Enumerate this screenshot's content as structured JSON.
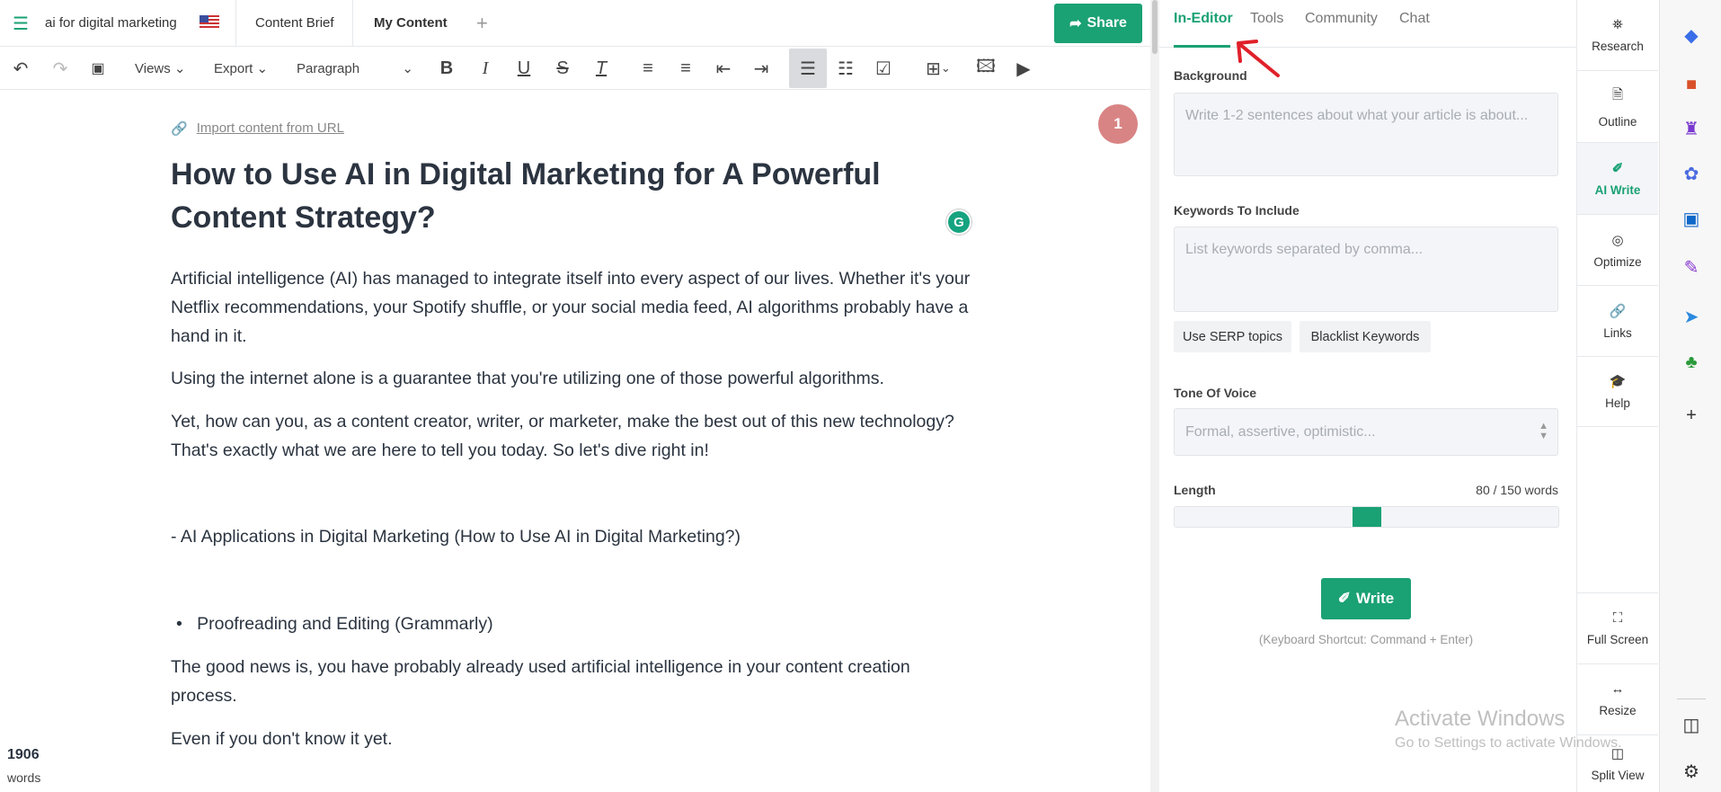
{
  "header": {
    "doc_title": "ai for digital marketing",
    "tabs": [
      "Content Brief",
      "My Content"
    ],
    "add_tab": "+",
    "share_label": "Share"
  },
  "toolbar": {
    "views": "Views",
    "export": "Export",
    "paragraph": "Paragraph"
  },
  "editor": {
    "import_link": "Import content from URL",
    "notification_count": "1",
    "title": "How to Use AI in Digital Marketing for A Powerful Content Strategy?",
    "paragraphs": [
      "Artificial intelligence (AI) has managed to integrate itself into every aspect of our lives. Whether it's your Netflix recommendations, your Spotify shuffle, or your social media feed, AI algorithms probably have a hand in it.",
      "Using the internet alone is a guarantee that you're utilizing one of those powerful algorithms.",
      "Yet, how can you, as a content creator, writer, or marketer, make the best out of this new technology? That's exactly what we are here to tell you today. So let's dive right in!",
      "- AI Applications in Digital Marketing (How to Use AI in Digital Marketing?)",
      "The good news is, you have probably already used artificial intelligence in your content creation process.",
      "Even if you don't know it yet."
    ],
    "bullet": "Proofreading and Editing (Grammarly)",
    "word_count": "1906",
    "word_label": "words"
  },
  "panel": {
    "tabs": [
      "In-Editor",
      "Tools",
      "Community",
      "Chat"
    ],
    "background_label": "Background",
    "background_placeholder": "Write 1-2 sentences about what your article is about...",
    "keywords_label": "Keywords To Include",
    "keywords_placeholder": "List keywords separated by comma...",
    "serp_button": "Use SERP topics",
    "blacklist_button": "Blacklist Keywords",
    "tone_label": "Tone Of Voice",
    "tone_placeholder": "Formal, assertive, optimistic...",
    "length_label": "Length",
    "length_value": "80 / 150 words",
    "length_slider_fraction": 0.5,
    "write_button": "Write",
    "shortcut_hint": "(Keyboard Shortcut: Command + Enter)"
  },
  "sidenav": {
    "top": [
      "Research",
      "Outline",
      "AI Write",
      "Optimize",
      "Links",
      "Help"
    ],
    "bottom": [
      "Full Screen",
      "Resize",
      "Split View"
    ]
  },
  "watermark": {
    "line1": "Activate Windows",
    "line2": "Go to Settings to activate Windows."
  },
  "colors": {
    "accent": "#1aa174",
    "badge": "#d98484"
  }
}
